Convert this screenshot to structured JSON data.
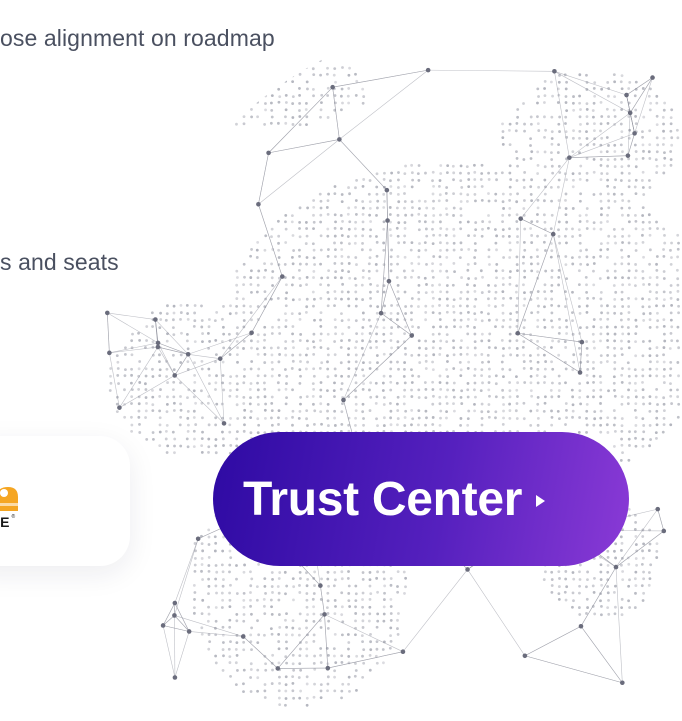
{
  "content": {
    "line_1": "ose alignment on roadmap",
    "line_2": "s and seats"
  },
  "logo": {
    "text": "RE",
    "accent_color": "#f5a623",
    "icon": "vendor-logo-icon"
  },
  "cta": {
    "label": "Trust Center",
    "arrow_icon": "triangle-right-icon",
    "gradient_start": "#2e0aa3",
    "gradient_end": "#8a3ad6"
  },
  "background": {
    "graphic": "dotted-globe-network-icon",
    "dot_color": "#9a9ca8"
  }
}
